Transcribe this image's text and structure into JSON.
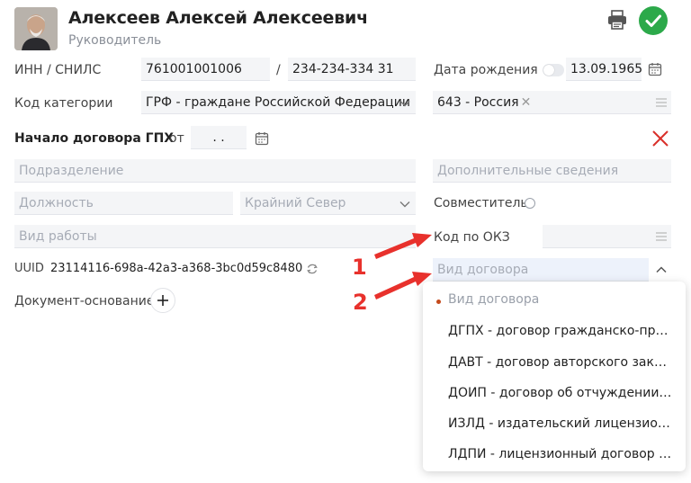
{
  "header": {
    "name": "Алексеев Алексей Алексеевич",
    "role": "Руководитель"
  },
  "form": {
    "inn_label": "ИНН / СНИЛС",
    "inn_value": "761001001006",
    "separator": "/",
    "snils_value": "234-234-334 31",
    "birth_label": "Дата рождения",
    "birth_value": "13.09.1965",
    "category_label": "Код категории",
    "category_value": "ГРФ - граждане Российской Федерации",
    "country_value": "643 - Россия",
    "contract_start_label": "Начало договора ГПХ",
    "from_label": "от",
    "date_value": ". .",
    "subdivision_placeholder": "Подразделение",
    "extra_placeholder": "Дополнительные сведения",
    "position_placeholder": "Должность",
    "north_placeholder": "Крайний Север",
    "part_time_label": "Совместитель",
    "work_type_placeholder": "Вид работы",
    "okz_label": "Код по ОКЗ",
    "uuid_label": "UUID",
    "uuid_value": "23114116-698a-42a3-a368-3bc0d59c8480",
    "contract_type_placeholder": "Вид договора",
    "basis_doc_label": "Документ-основание"
  },
  "dropdown": {
    "items": [
      "Вид договора",
      "ДГПХ - договор гражданско-правового характера",
      "ДАВТ - договор авторского заказа",
      "ДОИП - договор об отчуждении исключительного права",
      "ИЗЛД - издательский лицензионный договор",
      "ЛДПИ - лицензионный договор о предоставлении права использования"
    ]
  },
  "annotations": {
    "marker_1": "1",
    "marker_2": "2"
  },
  "colors": {
    "accent_green": "#2ca94a",
    "annotation_red": "#e8312c",
    "field_bg": "#f4f5f7"
  }
}
